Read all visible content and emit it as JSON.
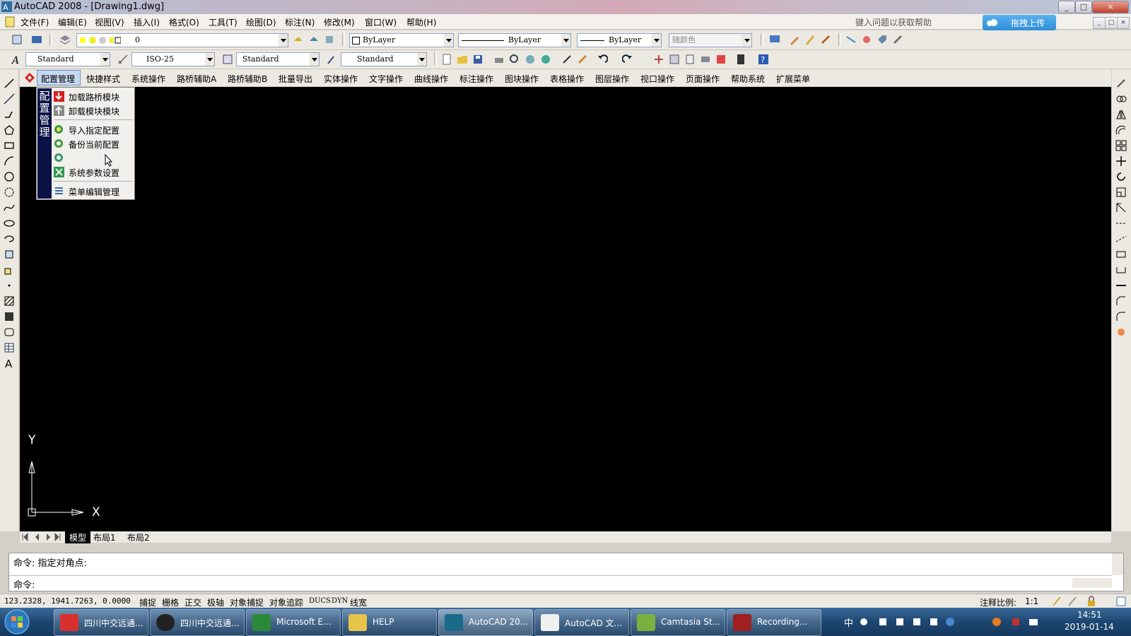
{
  "window": {
    "title": "AutoCAD 2008 - [Drawing1.dwg]",
    "controls": [
      "_",
      "□",
      "×"
    ]
  },
  "menubar": {
    "items": [
      "文件(F)",
      "编辑(E)",
      "视图(V)",
      "插入(I)",
      "格式(O)",
      "工具(T)",
      "绘图(D)",
      "标注(N)",
      "修改(M)",
      "窗口(W)",
      "帮助(H)"
    ],
    "help_search_placeholder": "键入问题以获取帮助",
    "upload_button": "拖拽上传"
  },
  "toolbar_layers": {
    "layer_value": "0",
    "color_value": "ByLayer",
    "linetype_value": "ByLayer",
    "lineweight_value": "ByLayer",
    "plotstyle_value": "随颜色"
  },
  "toolbar_styles": {
    "text_style": "Standard",
    "dim_style": "ISO-25",
    "table_style": "Standard",
    "mleader_style": "Standard"
  },
  "custom_menu": {
    "items": [
      "配置管理",
      "快捷样式",
      "系统操作",
      "路桥辅助A",
      "路桥辅助B",
      "批量导出",
      "实体操作",
      "文字操作",
      "曲线操作",
      "标注操作",
      "图块操作",
      "表格操作",
      "图层操作",
      "视口操作",
      "页面操作",
      "帮助系统",
      "扩展菜单"
    ]
  },
  "dropdown": {
    "side_label": "配置管理",
    "items": [
      "加载路桥模块",
      "卸载模块模块",
      "导入指定配置",
      "备份当前配置",
      "",
      "系统参数设置",
      "菜单编辑管理"
    ]
  },
  "ucs": {
    "y_label": "Y",
    "x_label": "X"
  },
  "layout_tabs": [
    "模型",
    "布局1",
    "布局2"
  ],
  "command": {
    "history_line": "命令: 指定对角点:",
    "prompt_line": "命令:"
  },
  "statusbar": {
    "coords": "123.2328,  1941.7263, 0.0000",
    "toggles": [
      "捕捉",
      "栅格",
      "正交",
      "极轴",
      "对象捕捉",
      "对象追踪",
      "DUCS",
      "DYN",
      "线宽"
    ],
    "annotation_scale_label": "注释比例:",
    "annotation_scale_value": "1:1"
  },
  "taskbar": {
    "tasks": [
      "四川中交远通...",
      "四川中交远通...",
      "Microsoft E...",
      "HELP",
      "AutoCAD 20...",
      "AutoCAD 文...",
      "Camtasia St...",
      "Recording..."
    ],
    "ime": "中",
    "time": "14:51",
    "date": "2019-01-14"
  },
  "colors": {
    "drawing_bg": "#000000",
    "dropdown_side": "#0a1246",
    "taskbar": "#1d4670"
  }
}
